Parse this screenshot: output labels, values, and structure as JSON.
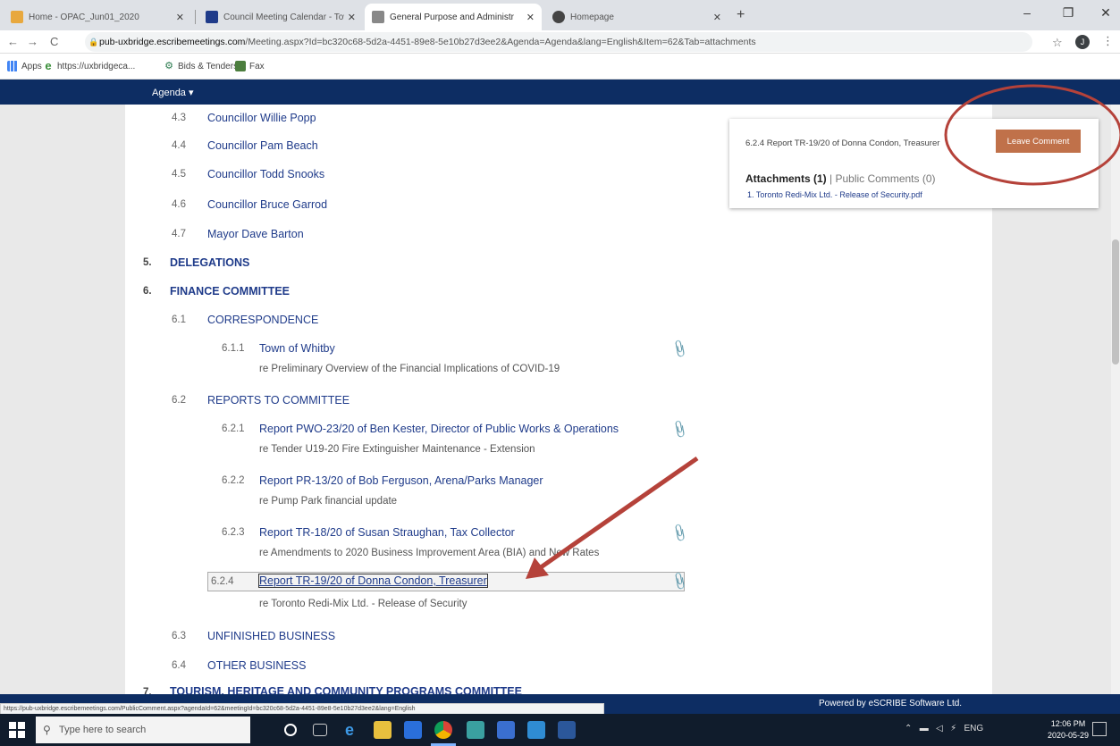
{
  "browser": {
    "tabs": [
      {
        "title": "Home - OPAC_Jun01_2020",
        "color": "#e8a83e"
      },
      {
        "title": "Council Meeting Calendar - Tow",
        "color": "#1f3b8a"
      },
      {
        "title": "General Purpose and Administr",
        "color": "#888888"
      },
      {
        "title": "Homepage",
        "color": "#444444"
      }
    ],
    "url_host": "pub-uxbridge.escribemeetings.com",
    "url_path": "/Meeting.aspx?Id=bc320c68-5d2a-4451-89e8-5e10b27d3ee2&Agenda=Agenda&lang=English&Item=62&Tab=attachments",
    "profile_initial": "J",
    "bookmarks": [
      "Apps",
      "https://uxbridgeca...",
      "Bids & Tenders",
      "Fax"
    ]
  },
  "site": {
    "agenda_menu": "Agenda ▾",
    "footer": "Powered by eSCRIBE Software Ltd."
  },
  "agenda": {
    "items": [
      {
        "num": "4.3",
        "text": "Councillor Willie Popp"
      },
      {
        "num": "4.4",
        "text": "Councillor Pam Beach"
      },
      {
        "num": "4.5",
        "text": "Councillor Todd Snooks"
      },
      {
        "num": "4.6",
        "text": "Councillor Bruce Garrod"
      },
      {
        "num": "4.7",
        "text": "Mayor Dave Barton"
      },
      {
        "num": "5.",
        "text": "DELEGATIONS"
      },
      {
        "num": "6.",
        "text": "FINANCE COMMITTEE"
      },
      {
        "num": "6.1",
        "text": "CORRESPONDENCE"
      },
      {
        "num": "6.1.1",
        "text": "Town of Whitby",
        "sub": "re Preliminary Overview of the Financial Implications of COVID-19"
      },
      {
        "num": "6.2",
        "text": "REPORTS TO COMMITTEE"
      },
      {
        "num": "6.2.1",
        "text": "Report PWO-23/20 of Ben Kester, Director of Public Works & Operations",
        "sub": "re Tender U19-20 Fire Extinguisher Maintenance - Extension"
      },
      {
        "num": "6.2.2",
        "text": "Report PR-13/20 of Bob Ferguson, Arena/Parks Manager",
        "sub": "re Pump Park financial update"
      },
      {
        "num": "6.2.3",
        "text": "Report TR-18/20 of Susan Straughan, Tax Collector",
        "sub": "re Amendments to 2020 Business Improvement Area (BIA) and New Rates"
      },
      {
        "num": "6.2.4",
        "text": "Report TR-19/20 of Donna Condon, Treasurer",
        "sub": "re Toronto Redi-Mix Ltd. - Release of Security"
      },
      {
        "num": "6.3",
        "text": "UNFINISHED BUSINESS"
      },
      {
        "num": "6.4",
        "text": "OTHER BUSINESS"
      },
      {
        "num": "7.",
        "text": "TOURISM, HERITAGE AND COMMUNITY PROGRAMS COMMITTEE"
      }
    ]
  },
  "panel": {
    "item": "6.2.4  Report TR-19/20 of Donna Condon, Treasurer",
    "leave_comment": "Leave Comment",
    "attachments_label": "Attachments (1)",
    "sep": " | ",
    "public_comments": "Public Comments (0)",
    "file": "1.  Toronto Redi-Mix Ltd. - Release of Security.pdf"
  },
  "status_url": "https://pub-uxbridge.escribemeetings.com/PublicComment.aspx?agendaId=62&meetingId=bc320c68-5d2a-4451-89e8-5e10b27d3ee2&lang=English",
  "taskbar": {
    "search_placeholder": "Type here to search",
    "lang": "ENG",
    "time": "12:06 PM",
    "date": "2020-05-29"
  },
  "colors": {
    "brand_navy": "#0d2d63",
    "link": "#1f3b8a",
    "comment_button": "#c0714a",
    "annotation_red": "#b5423a"
  }
}
